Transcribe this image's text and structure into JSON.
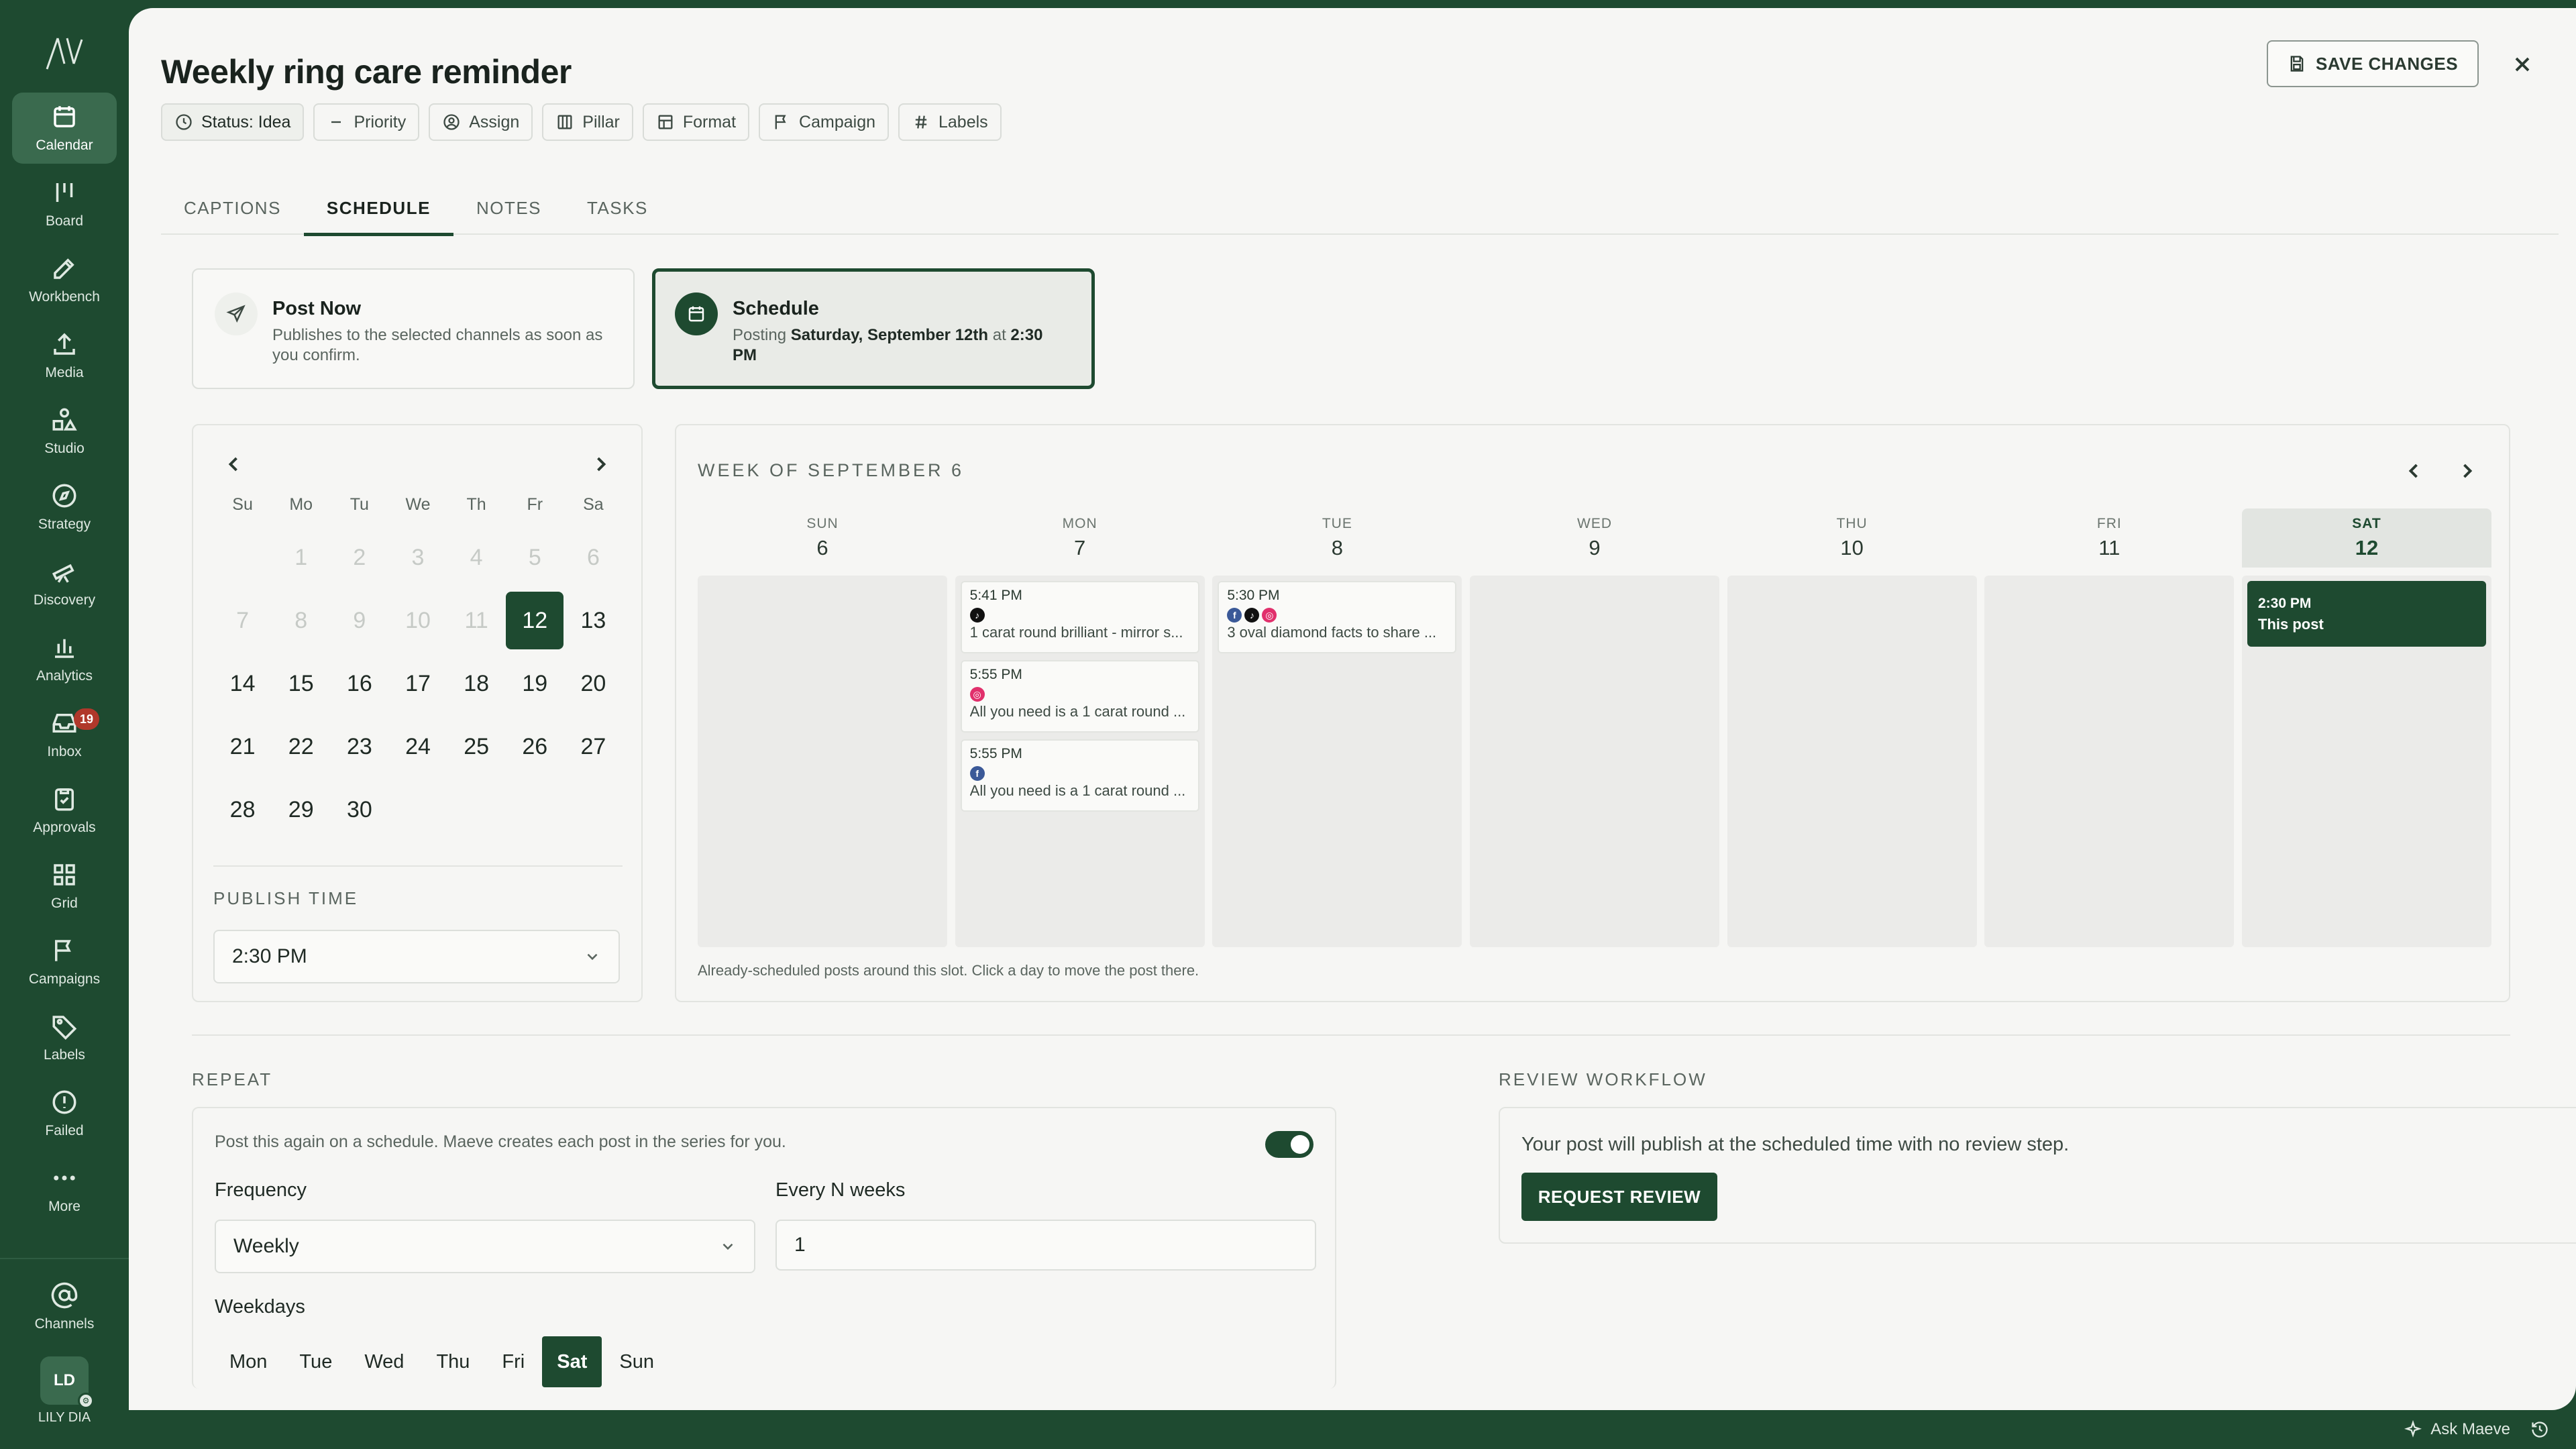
{
  "sidebar": {
    "items": [
      {
        "label": "Calendar",
        "icon": "calendar-icon",
        "active": true
      },
      {
        "label": "Board",
        "icon": "board-icon"
      },
      {
        "label": "Workbench",
        "icon": "workbench-icon"
      },
      {
        "label": "Media",
        "icon": "upload-icon"
      },
      {
        "label": "Studio",
        "icon": "shapes-icon"
      },
      {
        "label": "Strategy",
        "icon": "compass-icon"
      },
      {
        "label": "Discovery",
        "icon": "telescope-icon"
      },
      {
        "label": "Analytics",
        "icon": "bar-chart-icon"
      },
      {
        "label": "Inbox",
        "icon": "inbox-icon",
        "badge": "19"
      },
      {
        "label": "Approvals",
        "icon": "clipboard-check-icon"
      },
      {
        "label": "Grid",
        "icon": "grid-icon"
      },
      {
        "label": "Campaigns",
        "icon": "flag-icon"
      },
      {
        "label": "Labels",
        "icon": "tag-icon"
      },
      {
        "label": "Failed",
        "icon": "alert-circle-icon"
      },
      {
        "label": "More",
        "icon": "more-icon"
      }
    ],
    "channels_label": "Channels",
    "user": {
      "initials": "LD",
      "name": "LILY DIA"
    }
  },
  "header": {
    "title": "Weekly ring care reminder",
    "save_label": "SAVE CHANGES",
    "chips": [
      {
        "label": "Status: Idea",
        "icon": "status-circle-icon"
      },
      {
        "label": "Priority",
        "icon": "minus-icon"
      },
      {
        "label": "Assign",
        "icon": "user-circle-icon"
      },
      {
        "label": "Pillar",
        "icon": "columns-icon"
      },
      {
        "label": "Format",
        "icon": "layout-icon"
      },
      {
        "label": "Campaign",
        "icon": "flag-icon"
      },
      {
        "label": "Labels",
        "icon": "hash-icon"
      }
    ]
  },
  "tabs": [
    "CAPTIONS",
    "SCHEDULE",
    "NOTES",
    "TASKS"
  ],
  "active_tab": "SCHEDULE",
  "modes": {
    "post_now": {
      "title": "Post Now",
      "desc": "Publishes to the selected channels as soon as you confirm."
    },
    "schedule": {
      "title": "Schedule",
      "prefix": "Posting ",
      "date": "Saturday, September 12th",
      "at": " at ",
      "time": "2:30 PM"
    }
  },
  "mini_calendar": {
    "weekdays": [
      "Su",
      "Mo",
      "Tu",
      "We",
      "Th",
      "Fr",
      "Sa"
    ],
    "leading_blanks": 1,
    "muted_days": [
      1,
      2,
      3,
      4,
      5,
      6,
      7,
      8,
      9,
      10,
      11
    ],
    "selected_day": 12,
    "days_in_month": 30,
    "publish_time_label": "PUBLISH TIME",
    "publish_time": "2:30 PM"
  },
  "week": {
    "title": "WEEK OF SEPTEMBER 6",
    "note": "Already-scheduled posts around this slot. Click a day to move the post there.",
    "days": [
      {
        "name": "SUN",
        "num": "6",
        "posts": []
      },
      {
        "name": "MON",
        "num": "7",
        "posts": [
          {
            "time": "5:41 PM",
            "channels": [
              "tt"
            ],
            "text": "1 carat round brilliant - mirror s..."
          },
          {
            "time": "5:55 PM",
            "channels": [
              "ig"
            ],
            "text": "All you need is a 1 carat round ..."
          },
          {
            "time": "5:55 PM",
            "channels": [
              "fb"
            ],
            "text": "All you need is a 1 carat round ..."
          }
        ]
      },
      {
        "name": "TUE",
        "num": "8",
        "posts": [
          {
            "time": "5:30 PM",
            "channels": [
              "fb",
              "tt",
              "ig"
            ],
            "text": "3 oval diamond facts to share ..."
          }
        ]
      },
      {
        "name": "WED",
        "num": "9",
        "posts": []
      },
      {
        "name": "THU",
        "num": "10",
        "posts": []
      },
      {
        "name": "FRI",
        "num": "11",
        "posts": []
      },
      {
        "name": "SAT",
        "num": "12",
        "today": true,
        "posts": [
          {
            "time": "2:30 PM",
            "channels": [],
            "text": "This post",
            "this": true
          }
        ]
      }
    ]
  },
  "repeat": {
    "label": "REPEAT",
    "desc": "Post this again on a schedule. Maeve creates each post in the series for you.",
    "enabled": true,
    "frequency_label": "Frequency",
    "frequency": "Weekly",
    "every_label": "Every N weeks",
    "every_value": "1",
    "weekdays_label": "Weekdays",
    "weekdays": [
      {
        "label": "Mon"
      },
      {
        "label": "Tue"
      },
      {
        "label": "Wed"
      },
      {
        "label": "Thu"
      },
      {
        "label": "Fri"
      },
      {
        "label": "Sat",
        "on": true
      },
      {
        "label": "Sun"
      }
    ]
  },
  "review": {
    "label": "REVIEW WORKFLOW",
    "text": "Your post will publish at the scheduled time with no review step.",
    "button": "REQUEST REVIEW"
  },
  "status_bar": {
    "ask": "Ask Maeve"
  },
  "colors": {
    "brand": "#1e4a30",
    "badge": "#b0382b",
    "instagram": "#e1306c",
    "facebook": "#3b5998",
    "tiktok": "#111111"
  }
}
